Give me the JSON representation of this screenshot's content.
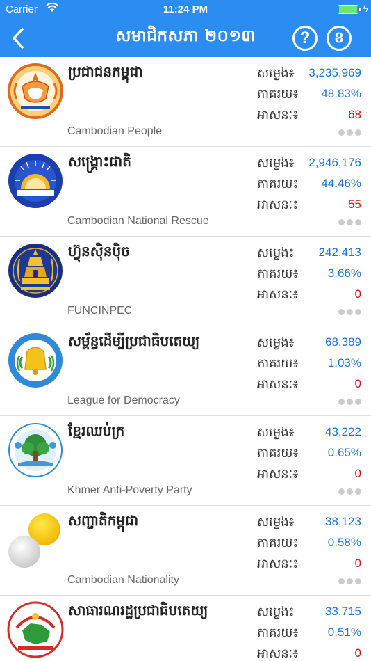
{
  "status": {
    "carrier": "Carrier",
    "time": "11:24 PM"
  },
  "nav": {
    "title": "សមាជិកសភា ២០១៣",
    "help": "?",
    "info": "ខ"
  },
  "labels": {
    "votes": "សម្លេង៖",
    "percent": "ភាគរយ៖",
    "seats": "អាសនៈ៖"
  },
  "colors": {
    "accent": "#2b8cf2",
    "value_blue": "#1a73d9",
    "seat_red": "#e0101a"
  },
  "parties": [
    {
      "name_kh": "ប្រជាជនកម្ពុជា",
      "name_en": "Cambodian People",
      "votes": "3,235,969",
      "percent": "48.83%",
      "seats": "68",
      "logo": "cpp-logo"
    },
    {
      "name_kh": "សង្គ្រោះជាតិ",
      "name_en": "Cambodian National Rescue",
      "votes": "2,946,176",
      "percent": "44.46%",
      "seats": "55",
      "logo": "cnrp-logo"
    },
    {
      "name_kh": "ហ៊្វុនស៊ិនប៉ិច",
      "name_en": "FUNCINPEC",
      "votes": "242,413",
      "percent": "3.66%",
      "seats": "0",
      "logo": "funcinpec-logo"
    },
    {
      "name_kh": "សម្ព័ន្ធដើម្បីប្រជាធិបតេយ្យ",
      "name_en": "League for Democracy",
      "votes": "68,389",
      "percent": "1.03%",
      "seats": "0",
      "logo": "ldp-logo"
    },
    {
      "name_kh": "ខ្មែរឈប់ក្រ",
      "name_en": "Khmer Anti-Poverty Party",
      "votes": "43,222",
      "percent": "0.65%",
      "seats": "0",
      "logo": "kapp-logo"
    },
    {
      "name_kh": "សញ្ជាតិកម្ពុជា",
      "name_en": "Cambodian Nationality",
      "votes": "38,123",
      "percent": "0.58%",
      "seats": "0",
      "logo": "cnp-logo"
    },
    {
      "name_kh": "សាធារណរដ្ឋប្រជាធិបតេយ្យ",
      "name_en": "",
      "votes": "33,715",
      "percent": "0.51%",
      "seats": "0",
      "logo": "rdp-logo"
    }
  ]
}
